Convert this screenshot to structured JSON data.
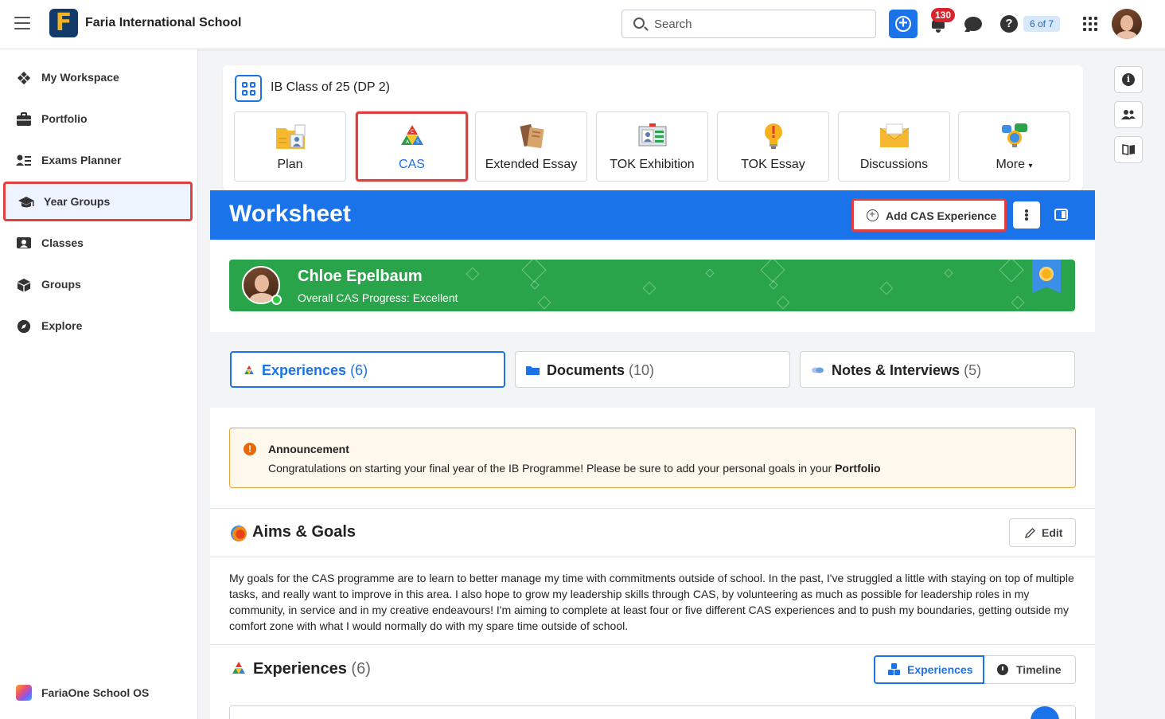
{
  "header": {
    "school_name": "Faria International School",
    "logo_letter": "F",
    "search_placeholder": "Search",
    "notification_count": "130",
    "page_count": "6 of 7"
  },
  "sidebar": {
    "items": [
      {
        "label": "My Workspace",
        "icon": "workspace-icon"
      },
      {
        "label": "Portfolio",
        "icon": "briefcase-icon"
      },
      {
        "label": "Exams Planner",
        "icon": "exams-list-icon"
      },
      {
        "label": "Year Groups",
        "icon": "graduation-cap-icon",
        "active": true
      },
      {
        "label": "Classes",
        "icon": "classes-icon"
      },
      {
        "label": "Groups",
        "icon": "cube-icon"
      },
      {
        "label": "Explore",
        "icon": "compass-icon"
      }
    ],
    "footer_label": "FariaOne School OS"
  },
  "class_header": {
    "title": "IB Class of 25 (DP 2)"
  },
  "app_tabs": [
    {
      "label": "Plan",
      "icon": "plan-folder-icon"
    },
    {
      "label": "CAS",
      "icon": "cas-triangle-icon",
      "active": true
    },
    {
      "label": "Extended Essay",
      "icon": "essay-book-icon"
    },
    {
      "label": "TOK Exhibition",
      "icon": "exhibition-screen-icon"
    },
    {
      "label": "TOK Essay",
      "icon": "lightbulb-icon"
    },
    {
      "label": "Discussions",
      "icon": "envelope-icon"
    },
    {
      "label": "More",
      "icon": "more-bubbles-icon"
    }
  ],
  "worksheet": {
    "title": "Worksheet",
    "add_button_label": "Add CAS Experience"
  },
  "student": {
    "name": "Chloe Epelbaum",
    "progress": "Overall CAS Progress: Excellent"
  },
  "subtabs": [
    {
      "label": "Experiences",
      "count": "(6)",
      "active": true
    },
    {
      "label": "Documents",
      "count": "(10)"
    },
    {
      "label": "Notes & Interviews",
      "count": "(5)"
    }
  ],
  "announcement": {
    "title": "Announcement",
    "body": "Congratulations on starting your final year of the IB Programme! Please be sure to add your personal goals in your ",
    "link": "Portfolio"
  },
  "aims": {
    "title": "Aims & Goals",
    "edit_label": "Edit",
    "text": "My goals for the CAS programme are to learn to better manage my time with commitments outside of school. In the past, I've struggled a little with staying on top of multiple tasks, and really want to improve in this area. I also hope to grow my leadership skills through CAS, by volunteering as much as possible for leadership roles in my community, in service and in my creative endeavours! I'm aiming to complete at least four or five different CAS experiences and to push my boundaries, getting outside my comfort zone with what I would normally do with my spare time outside of school."
  },
  "experiences": {
    "title": "Experiences",
    "count": "(6)",
    "view_experiences": "Experiences",
    "view_timeline": "Timeline"
  },
  "colors": {
    "accent": "#1a73e8",
    "banner": "#2aa44a",
    "highlight": "#e04040",
    "announcement_border": "#e8a33d"
  }
}
